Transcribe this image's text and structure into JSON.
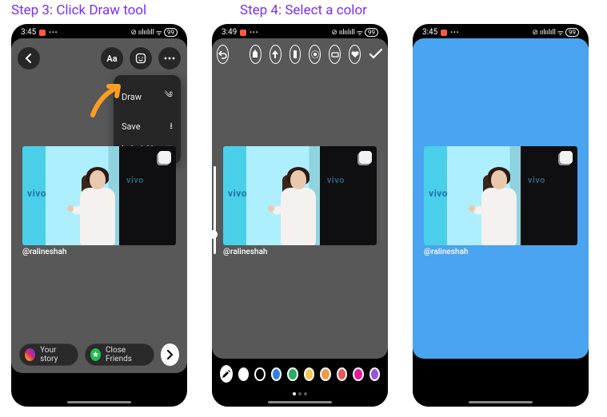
{
  "captions": {
    "step3": "Step 3: Click Draw tool",
    "step4": "Step 4: Select a color"
  },
  "status": {
    "time1": "3:45",
    "time2": "3:49",
    "time3": "3:45",
    "signal": "ıılıılıll",
    "wifi": "◉",
    "battery": "99"
  },
  "menu": {
    "draw": "Draw",
    "save": "Save",
    "label": "Label AI"
  },
  "photo": {
    "brand": "vivo",
    "credit": "@ralineshah"
  },
  "footer": {
    "your_story": "Your story",
    "close_friends": "Close Friends"
  },
  "topbar": {
    "text_label": "Aa"
  },
  "palette": {
    "colors": [
      "#ffffff",
      "#000000",
      "#2f80ed",
      "#27ae60",
      "#f2c94c",
      "#f2994a",
      "#eb5757",
      "#e7189b",
      "#9b51e0"
    ]
  }
}
